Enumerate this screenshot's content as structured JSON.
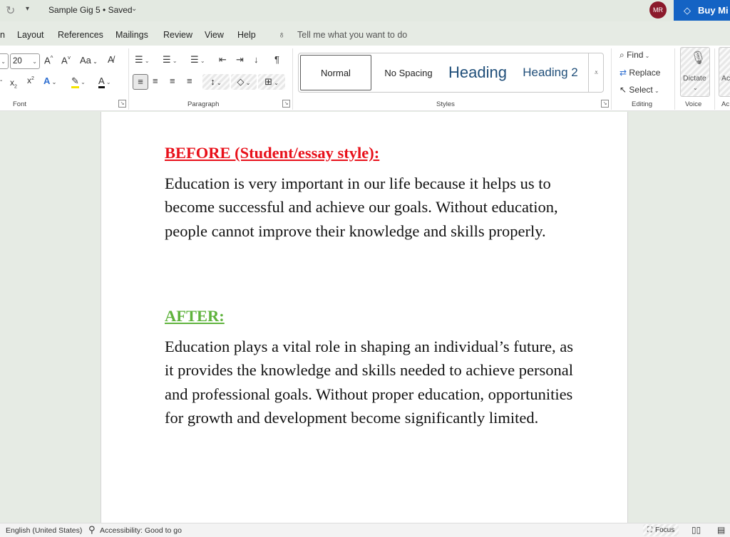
{
  "titlebar": {
    "doc_title": "Sample Gig 5 • Saved",
    "avatar_initials": "MR",
    "buy_button": "Buy Mi"
  },
  "menu": {
    "tabs": [
      "n",
      "Layout",
      "References",
      "Mailings",
      "Review",
      "View",
      "Help"
    ],
    "tell_me": "Tell me what you want to do"
  },
  "ribbon": {
    "font_size": "20",
    "change_case": "Aa",
    "groups": {
      "font": "Font",
      "paragraph": "Paragraph",
      "styles": "Styles",
      "editing": "Editing",
      "voice": "Voice",
      "accessibility": "Ac"
    },
    "styles": {
      "normal": "Normal",
      "no_spacing": "No Spacing",
      "heading1": "Heading",
      "heading2": "Heading 2"
    },
    "editing": {
      "find": "Find",
      "replace": "Replace",
      "select": "Select"
    },
    "voice": {
      "dictate": "Dictate"
    },
    "accessibility_btn": "Ac"
  },
  "document": {
    "before_heading": "BEFORE (Student/essay style):",
    "before_body": "Education is very important in our life because it helps us to become successful and achieve our goals. Without education, people cannot improve their knowledge and skills properly.",
    "after_heading": "AFTER:",
    "after_body": "Education plays a vital role in shaping an individual’s future, as it provides the knowledge and skills needed to achieve personal and professional goals. Without proper education, opportunities for growth and development become significantly limited."
  },
  "statusbar": {
    "language": "English (United States)",
    "accessibility": "Accessibility: Good to go",
    "focus": "Focus"
  },
  "colors": {
    "before_heading": "#e8101a",
    "after_heading": "#5fb33d",
    "heading_style": "#1f4e79",
    "buy_button": "#1463c4",
    "avatar": "#8b1a2b"
  }
}
